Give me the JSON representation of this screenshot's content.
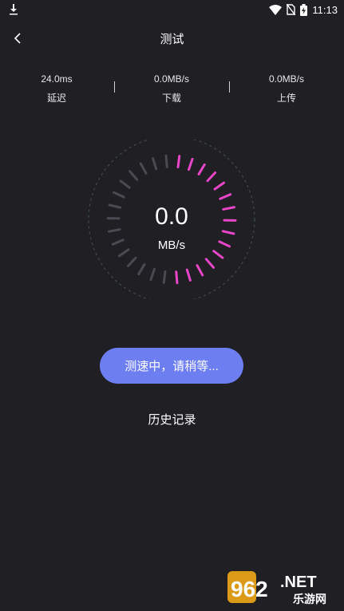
{
  "status_bar": {
    "time": "11:13",
    "icons": [
      "download-icon",
      "wifi-icon",
      "no-sim-icon",
      "battery-charging-icon"
    ]
  },
  "header": {
    "title": "测试",
    "back_icon": "chevron-left-icon"
  },
  "stats": {
    "latency": {
      "value": "24.0ms",
      "label": "延迟"
    },
    "download": {
      "value": "0.0MB/s",
      "label": "下载"
    },
    "upload": {
      "value": "0.0MB/s",
      "label": "上传"
    }
  },
  "gauge": {
    "value": "0.0",
    "unit": "MB/s",
    "active_color": "#e846c8",
    "inactive_color": "#4a4a52"
  },
  "actions": {
    "test_button_label": "测速中，请稍等...",
    "history_label": "历史记录"
  },
  "watermark": {
    "brand": "962.NET",
    "subtitle": "乐游网"
  },
  "colors": {
    "background": "#1f1f24",
    "button": "#6c7ef0"
  }
}
